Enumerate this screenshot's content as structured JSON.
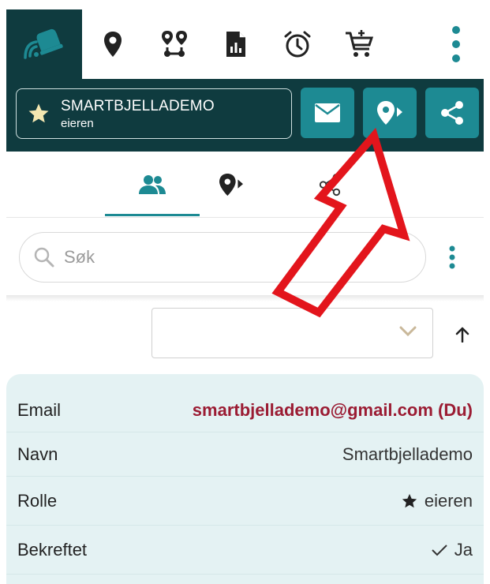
{
  "header": {
    "group_name": "SMARTBJELLADEMO",
    "group_role": "eieren"
  },
  "search": {
    "placeholder": "Søk"
  },
  "member": {
    "rows": [
      {
        "label": "Email",
        "value": "smartbjellademo@gmail.com (Du)"
      },
      {
        "label": "Navn",
        "value": "Smartbjellademo"
      },
      {
        "label": "Rolle",
        "value": "eieren"
      },
      {
        "label": "Bekreftet",
        "value": "Ja"
      }
    ]
  },
  "icons": {
    "logo": "bell-signal-icon",
    "top": [
      "location-pin-icon",
      "route-icon",
      "report-icon",
      "alarm-clock-icon",
      "cart-add-icon",
      "more-vertical-icon"
    ],
    "header_buttons": [
      "mail-icon",
      "location-share-icon",
      "share-icon"
    ],
    "tabs": [
      "users-icon",
      "location-share-icon",
      "share-icon"
    ]
  },
  "colors": {
    "header_bg": "#0f3b3f",
    "accent": "#1d8a93",
    "card_bg": "#e4f2f3",
    "email": "#9b1c33",
    "annotation_arrow": "#e3151c"
  }
}
